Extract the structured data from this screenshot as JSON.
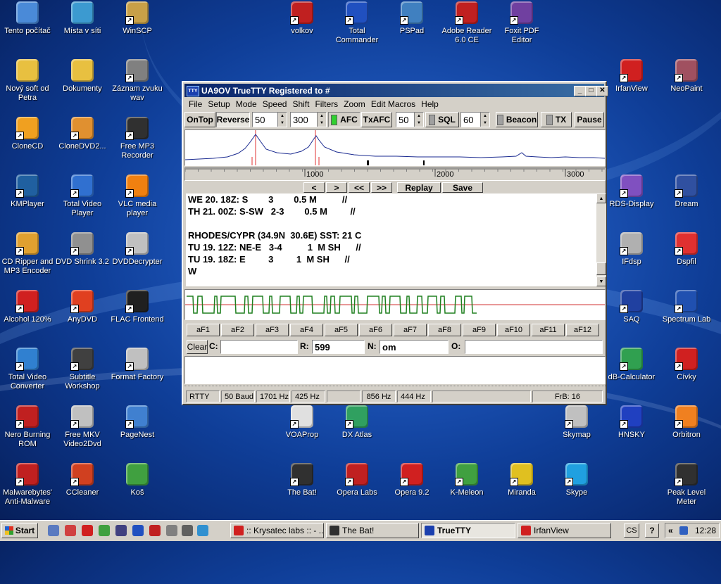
{
  "desktop": {
    "icons": [
      {
        "label": "Tento počítač",
        "color": "#4a8ad8"
      },
      {
        "label": "Místa v síti",
        "color": "#3c9ad0"
      },
      {
        "label": "WinSCP",
        "color": "#c8a048"
      },
      {
        "label": "volkov",
        "color": "#c02020"
      },
      {
        "label": "Total Commander",
        "color": "#2050c0"
      },
      {
        "label": "PSPad",
        "color": "#4080c0"
      },
      {
        "label": "Adobe Reader 6.0 CE",
        "color": "#c02020"
      },
      {
        "label": "Foxit PDF Editor",
        "color": "#7040a0"
      },
      {
        "label": "Nový soft od Petra",
        "color": "#e8c040"
      },
      {
        "label": "Dokumenty",
        "color": "#e8c040"
      },
      {
        "label": "Záznam zvuku wav",
        "color": "#808080"
      },
      {
        "label": "IrfanView",
        "color": "#d02020"
      },
      {
        "label": "NeoPaint",
        "color": "#a05060"
      },
      {
        "label": "CloneCD",
        "color": "#f0a020"
      },
      {
        "label": "CloneDVD2...",
        "color": "#e09030"
      },
      {
        "label": "Free MP3 Recorder",
        "color": "#303030"
      },
      {
        "label": "KMPlayer",
        "color": "#2060a0"
      },
      {
        "label": "Total Video Player",
        "color": "#3070d0"
      },
      {
        "label": "VLC media player",
        "color": "#f08010"
      },
      {
        "label": "RDS-Display",
        "color": "#8050c0"
      },
      {
        "label": "Dream",
        "color": "#3050a0"
      },
      {
        "label": "CD Ripper and MP3 Encoder",
        "color": "#e0a030"
      },
      {
        "label": "DVD Shrink 3.2",
        "color": "#909090"
      },
      {
        "label": "DVDDecrypter",
        "color": "#c0c0c0"
      },
      {
        "label": "IFdsp",
        "color": "#b0b0b0"
      },
      {
        "label": "Dspfil",
        "color": "#e03030"
      },
      {
        "label": "Alcohol 120%",
        "color": "#d02020"
      },
      {
        "label": "AnyDVD",
        "color": "#e04020"
      },
      {
        "label": "FLAC Frontend",
        "color": "#202020"
      },
      {
        "label": "SAQ",
        "color": "#2040a0"
      },
      {
        "label": "Spectrum Lab",
        "color": "#2050b0"
      },
      {
        "label": "Total Video Converter",
        "color": "#3080d0"
      },
      {
        "label": "Subtitle Workshop",
        "color": "#404040"
      },
      {
        "label": "Format Factory",
        "color": "#c0c0c0"
      },
      {
        "label": "dB-Calculator",
        "color": "#30a050"
      },
      {
        "label": "Cívky",
        "color": "#d02020"
      },
      {
        "label": "Nero Burning ROM",
        "color": "#c02020"
      },
      {
        "label": "Free MKV Video2Dvd",
        "color": "#c0c0c0"
      },
      {
        "label": "PageNest",
        "color": "#4080d0"
      },
      {
        "label": "VOAProp",
        "color": "#e0e0e0"
      },
      {
        "label": "DX Atlas",
        "color": "#30a060"
      },
      {
        "label": "Skymap",
        "color": "#c0c0c0"
      },
      {
        "label": "HNSKY",
        "color": "#2040c0"
      },
      {
        "label": "Orbitron",
        "color": "#f08020"
      },
      {
        "label": "Malwarebytes' Anti-Malware",
        "color": "#c02020"
      },
      {
        "label": "CCleaner",
        "color": "#d04020"
      },
      {
        "label": "Koš",
        "color": "#40a040"
      },
      {
        "label": "The Bat!",
        "color": "#303030"
      },
      {
        "label": "Opera Labs",
        "color": "#c02020"
      },
      {
        "label": "Opera 9.2",
        "color": "#d02020"
      },
      {
        "label": "K-Meleon",
        "color": "#40a040"
      },
      {
        "label": "Miranda",
        "color": "#e0c020"
      },
      {
        "label": "Skype",
        "color": "#20a0e0"
      },
      {
        "label": "Peak Level Meter",
        "color": "#303030"
      }
    ]
  },
  "window": {
    "title": "UA9OV TrueTTY    Registered to  #",
    "icon_text": "TTY",
    "menu": [
      "File",
      "Setup",
      "Mode",
      "Speed",
      "Shift",
      "Filters",
      "Zoom",
      "Edit Macros",
      "Help"
    ],
    "toolbar": {
      "ontop": "OnTop",
      "reverse": "Reverse",
      "baud_value": "50",
      "shift_value": "300",
      "afc": "AFC",
      "txafc": "TxAFC",
      "sql_value": "50",
      "sql": "SQL",
      "level_value": "60",
      "beacon": "Beacon",
      "tx": "TX",
      "pause": "Pause"
    },
    "freq_scale": [
      "1000",
      "2000",
      "3000"
    ],
    "nav": {
      "back": "<",
      "fwd": ">",
      "back2": "<<",
      "fwd2": ">>",
      "replay": "Replay",
      "save": "Save"
    },
    "text_lines": [
      "WE 20. 18Z: S        3        0.5 M          //",
      "TH 21. 00Z: S-SW   2-3        0.5 M         //",
      "",
      "RHODES/CYPR (34.9N  30.6E) SST: 21 C",
      "TU 19. 12Z: NE-E   3-4          1  M SH      //",
      "TU 19. 18Z: E         3         1  M SH      //",
      "W"
    ],
    "fkeys": [
      "aF1",
      "aF2",
      "aF3",
      "aF4",
      "aF5",
      "aF6",
      "aF7",
      "aF8",
      "aF9",
      "aF10",
      "aF11",
      "aF12"
    ],
    "log": {
      "clear": "Clear",
      "c_label": "C:",
      "c_value": "",
      "r_label": "R:",
      "r_value": "599",
      "n_label": "N:",
      "n_value": "om",
      "o_label": "O:",
      "o_value": ""
    },
    "status": [
      "RTTY",
      "50 Baud",
      "1701 Hz",
      "425 Hz",
      "",
      "856 Hz",
      "444 Hz",
      "",
      "FrB: 16"
    ]
  },
  "taskbar": {
    "start": "Start",
    "tasks": [
      {
        "label": ":: Krysatec labs :: - ...",
        "color": "#d02020"
      },
      {
        "label": "The Bat!",
        "color": "#303030"
      },
      {
        "label": "TrueTTY",
        "color": "#1a3fae"
      },
      {
        "label": "IrfanView",
        "color": "#d02020"
      }
    ],
    "lang": "CS",
    "help": "?",
    "clock": "12:28"
  }
}
